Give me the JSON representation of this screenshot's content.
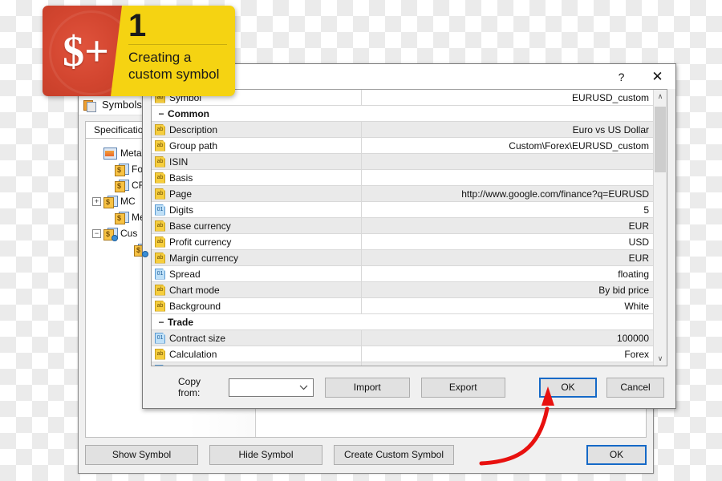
{
  "badge": {
    "logo": "$+",
    "number": "1",
    "line1": "Creating a",
    "line2": "custom symbol",
    "red": "#d2452f",
    "yellow": "#f5d312"
  },
  "symbols_window": {
    "title": "Symbols",
    "title_icon": "symbols-window-icon",
    "tab": "Specification",
    "tree": [
      {
        "label": "MetaTra",
        "expander": "",
        "indent": 0,
        "icon": "folder-main"
      },
      {
        "label": "For",
        "expander": "",
        "indent": 1,
        "icon": "symbol-folder"
      },
      {
        "label": "CFI",
        "expander": "",
        "indent": 1,
        "icon": "symbol-folder"
      },
      {
        "label": "MC",
        "expander": "+",
        "indent": 1,
        "icon": "symbol-folder"
      },
      {
        "label": "Me",
        "expander": "",
        "indent": 1,
        "icon": "symbol-folder"
      },
      {
        "label": "Cus",
        "expander": "−",
        "indent": 1,
        "icon": "symbol-folder-custom"
      },
      {
        "label": "",
        "expander": "",
        "indent": 2,
        "icon": "symbol-folder-custom"
      }
    ],
    "buttons": {
      "show_symbol": "Show Symbol",
      "hide_symbol": "Hide Symbol",
      "create_custom_symbol": "Create Custom Symbol",
      "ok": "OK"
    }
  },
  "dialog": {
    "title": "",
    "help_glyph": "?",
    "close_glyph": "✕",
    "scrollbar": {
      "up": "∧",
      "down": "∨"
    },
    "rows": [
      {
        "kind": "prop",
        "type": "text",
        "name": "Symbol",
        "value": "EURUSD_custom"
      },
      {
        "kind": "group",
        "toggle": "−",
        "name": "Common",
        "value": ""
      },
      {
        "kind": "prop",
        "type": "text",
        "name": "Description",
        "value": "Euro vs US Dollar"
      },
      {
        "kind": "prop",
        "type": "text",
        "name": "Group path",
        "value": "Custom\\Forex\\EURUSD_custom"
      },
      {
        "kind": "prop",
        "type": "text",
        "name": "ISIN",
        "value": ""
      },
      {
        "kind": "prop",
        "type": "text",
        "name": "Basis",
        "value": ""
      },
      {
        "kind": "prop",
        "type": "text",
        "name": "Page",
        "value": "http://www.google.com/finance?q=EURUSD"
      },
      {
        "kind": "prop",
        "type": "num",
        "name": "Digits",
        "value": "5"
      },
      {
        "kind": "prop",
        "type": "text",
        "name": "Base currency",
        "value": "EUR"
      },
      {
        "kind": "prop",
        "type": "text",
        "name": "Profit currency",
        "value": "USD"
      },
      {
        "kind": "prop",
        "type": "text",
        "name": "Margin currency",
        "value": "EUR"
      },
      {
        "kind": "prop",
        "type": "num",
        "name": "Spread",
        "value": "floating"
      },
      {
        "kind": "prop",
        "type": "text",
        "name": "Chart mode",
        "value": "By bid price"
      },
      {
        "kind": "prop",
        "type": "text",
        "name": "Background",
        "value": "White"
      },
      {
        "kind": "group",
        "toggle": "−",
        "name": "Trade",
        "value": ""
      },
      {
        "kind": "prop",
        "type": "num",
        "name": "Contract size",
        "value": "100000"
      },
      {
        "kind": "prop",
        "type": "text",
        "name": "Calculation",
        "value": "Forex"
      }
    ],
    "footer": {
      "copy_from_label": "Copy from:",
      "copy_from_value": "",
      "copy_from_placeholder": "",
      "import": "Import",
      "export": "Export",
      "ok": "OK",
      "cancel": "Cancel"
    }
  },
  "annotation": {
    "arrow_color": "#e8110f",
    "arrow_name": "red-curved-arrow-to-ok"
  }
}
